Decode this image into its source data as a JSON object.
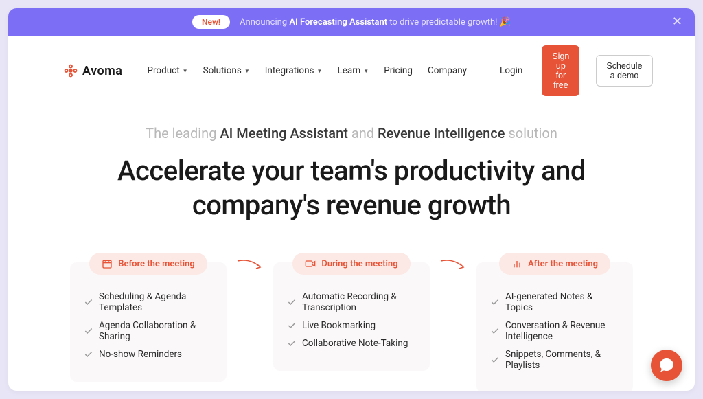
{
  "banner": {
    "badge": "New!",
    "prefix": "Announcing ",
    "bold": "AI Forecasting Assistant",
    "suffix": " to drive predictable growth! 🎉"
  },
  "brand": {
    "name": "Avoma"
  },
  "nav": {
    "items": [
      "Product",
      "Solutions",
      "Integrations",
      "Learn",
      "Pricing",
      "Company"
    ],
    "login": "Login",
    "signup": "Sign up for free",
    "demo": "Schedule a demo"
  },
  "hero": {
    "sub_prefix": "The leading ",
    "sub_b1": "AI Meeting Assistant",
    "sub_mid": " and ",
    "sub_b2": "Revenue Intelligence",
    "sub_suffix": " solution",
    "headline_l1": "Accelerate your team's productivity and",
    "headline_l2": "company's revenue growth"
  },
  "stages": [
    {
      "label": "Before the meeting",
      "icon": "calendar",
      "features": [
        "Scheduling & Agenda Templates",
        "Agenda Collaboration & Sharing",
        "No-show Reminders"
      ]
    },
    {
      "label": "During the meeting",
      "icon": "video",
      "features": [
        "Automatic Recording & Transcription",
        "Live Bookmarking",
        "Collaborative Note-Taking"
      ]
    },
    {
      "label": "After the meeting",
      "icon": "bars",
      "features": [
        "AI-generated Notes & Topics",
        "Conversation & Revenue Intelligence",
        "Snippets, Comments, & Playlists"
      ]
    }
  ],
  "colors": {
    "accent": "#e65336",
    "banner": "#7c6ef5"
  }
}
